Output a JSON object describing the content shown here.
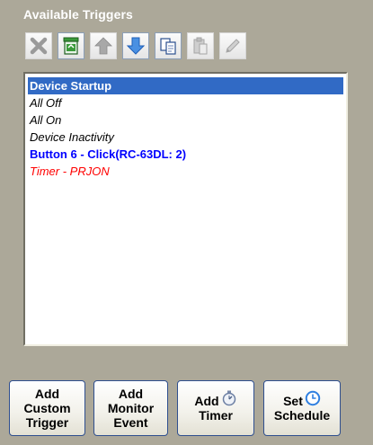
{
  "section": {
    "title": "Available Triggers"
  },
  "toolbar": {
    "buttons": [
      {
        "icon": "delete-x-icon",
        "enabled": false
      },
      {
        "icon": "recycle-bin-icon",
        "enabled": true
      },
      {
        "icon": "arrow-up-icon",
        "enabled": false
      },
      {
        "icon": "arrow-down-icon",
        "enabled": true
      },
      {
        "icon": "copy-icon",
        "enabled": true
      },
      {
        "icon": "paste-icon",
        "enabled": false
      },
      {
        "icon": "pencil-edit-icon",
        "enabled": false
      }
    ]
  },
  "triggers": {
    "items": [
      {
        "label": "Device Startup",
        "style": "selected"
      },
      {
        "label": "All Off",
        "style": "italic"
      },
      {
        "label": "All On",
        "style": "italic"
      },
      {
        "label": "Device Inactivity",
        "style": "italic"
      },
      {
        "label": "Button 6 - Click(RC-63DL: 2)",
        "style": "bold-blue"
      },
      {
        "label": "Timer - PRJON",
        "style": "red-italic"
      }
    ]
  },
  "actions": {
    "add_custom_trigger": {
      "line1": "Add",
      "line2": "Custom",
      "line3": "Trigger"
    },
    "add_monitor_event": {
      "line1": "Add",
      "line2": "Monitor",
      "line3": "Event"
    },
    "add_timer": {
      "line1": "Add",
      "line2": "Timer",
      "icon": "stopwatch-icon"
    },
    "set_schedule": {
      "line1": "Set",
      "line2": "Schedule",
      "icon": "clock-icon"
    }
  },
  "colors": {
    "panel_bg": "#aca899",
    "selection": "#316ac5",
    "button_trigger_text": "#0000ff",
    "timer_trigger_text": "#ff0000"
  }
}
